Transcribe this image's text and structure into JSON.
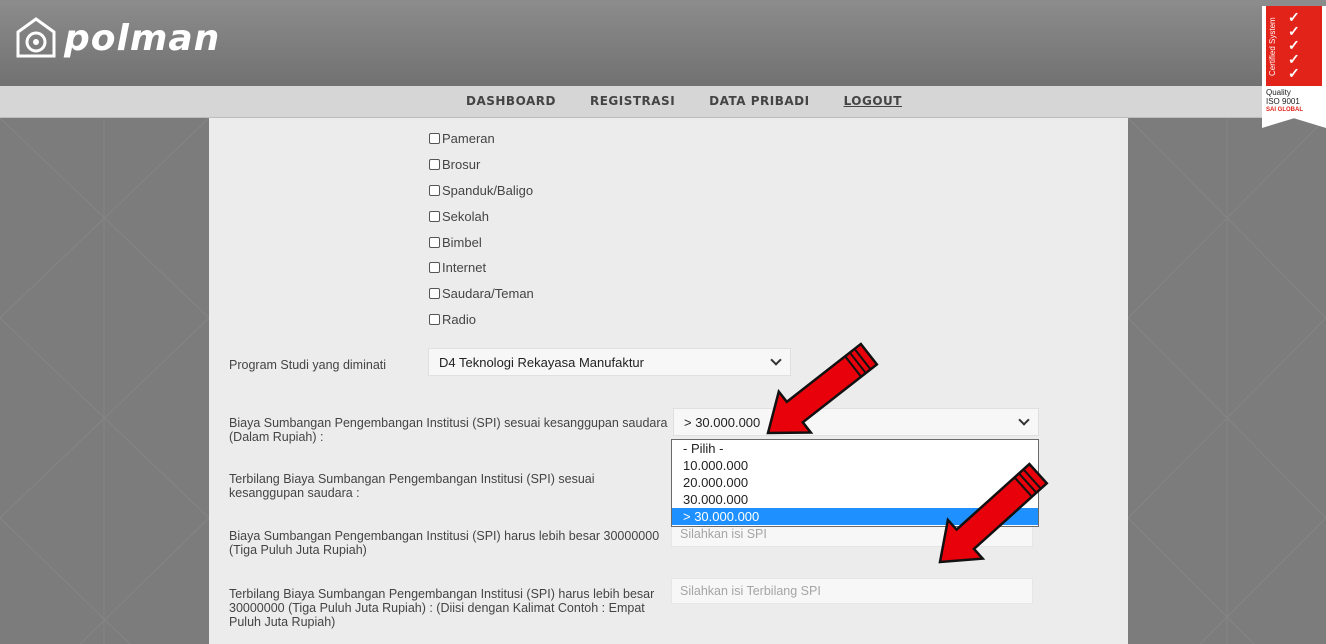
{
  "header": {
    "logo_text": "polman",
    "cert": {
      "side_text": "Certified System",
      "line1": "Quality",
      "line2": "ISO 9001",
      "brand": "SAI GLOBAL"
    }
  },
  "nav": {
    "items": [
      "DASHBOARD",
      "REGISTRASI",
      "DATA PRIBADI",
      "LOGOUT"
    ]
  },
  "checkboxes": [
    "Pameran",
    "Brosur",
    "Spanduk/Baligo",
    "Sekolah",
    "Bimbel",
    "Internet",
    "Saudara/Teman",
    "Radio"
  ],
  "program": {
    "label": "Program Studi yang diminati",
    "value": "D4 Teknologi Rekayasa Manufaktur"
  },
  "spi": {
    "label": "Biaya Sumbangan Pengembangan Institusi (SPI) sesuai kesanggupan saudara (Dalam Rupiah) :",
    "value": "> 30.000.000",
    "options": [
      "- Pilih -",
      "10.000.000",
      "20.000.000",
      "30.000.000",
      "> 30.000.000"
    ],
    "selected_index": 4
  },
  "terbilang": {
    "label": "Terbilang Biaya Sumbangan Pengembangan Institusi (SPI) sesuai kesanggupan saudara :"
  },
  "spi_more": {
    "label": "Biaya Sumbangan Pengembangan Institusi (SPI) harus lebih besar 30000000 (Tiga Puluh Juta Rupiah)",
    "placeholder": "Silahkan isi SPI"
  },
  "terbilang_more": {
    "label": "Terbilang Biaya Sumbangan Pengembangan Institusi (SPI) harus lebih besar 30000000 (Tiga Puluh Juta Rupiah) : (Diisi dengan Kalimat Contoh : Empat Puluh Juta Rupiah)",
    "placeholder": "Silahkan isi Terbilang SPI"
  },
  "colors": {
    "header_bg": "#7a7a7a",
    "nav_bg": "#d6d6d6",
    "panel_bg": "#ececec",
    "option_selected": "#1e90ff",
    "arrow": "#e8000b",
    "cert_red": "#e2231a"
  }
}
